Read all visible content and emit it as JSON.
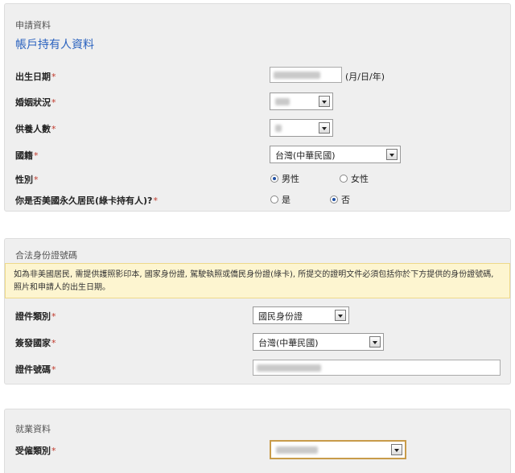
{
  "applicant": {
    "section_title": "申請資料",
    "subtitle": "帳戶持有人資料",
    "required_mark": "*",
    "dob_label": "出生日期",
    "dob_hint": "(月/日/年)",
    "marital_label": "婚姻狀況",
    "dependents_label": "供養人數",
    "nationality_label": "國籍",
    "nationality_value": "台灣(中華民國)",
    "gender_label": "性別",
    "gender_options": [
      "男性",
      "女性"
    ],
    "gender_selected": "男性",
    "pr_label": "你是否美國永久居民(綠卡持有人)?",
    "pr_options": [
      "是",
      "否"
    ],
    "pr_selected": "否"
  },
  "identity": {
    "section_title": "合法身份證號碼",
    "notice": "如為非美國居民, 需提供護照影印本, 國家身份證, 駕駛執照或僑民身份證(綠卡), 所提交的證明文件必須包括你於下方提供的身份證號碼, 照片和申請人的出生日期。",
    "doc_type_label": "證件類別",
    "doc_type_value": "國民身份證",
    "issuing_country_label": "簽發國家",
    "issuing_country_value": "台灣(中華民國)",
    "doc_number_label": "證件號碼"
  },
  "employment": {
    "section_title": "就業資料",
    "employment_type_label": "受僱類別"
  }
}
